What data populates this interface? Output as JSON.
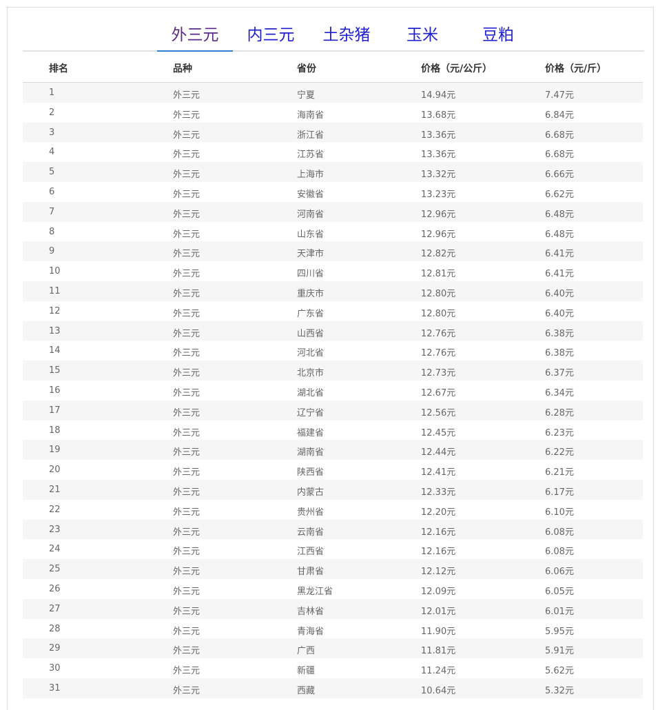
{
  "tabs": [
    "外三元",
    "内三元",
    "土杂猪",
    "玉米",
    "豆粕"
  ],
  "active_tab": 0,
  "colors": {
    "tab_text": "#1f1fcf",
    "tab_active_text": "#5b2a86",
    "tab_underline": "#2f7fd1",
    "zebra": "#f6f6f6"
  },
  "table": {
    "headers": [
      "排名",
      "品种",
      "省份",
      "价格（元/公斤）",
      "价格（元/斤）"
    ],
    "rows": [
      [
        "1",
        "外三元",
        "宁夏",
        "14.94元",
        "7.47元"
      ],
      [
        "2",
        "外三元",
        "海南省",
        "13.68元",
        "6.84元"
      ],
      [
        "3",
        "外三元",
        "浙江省",
        "13.36元",
        "6.68元"
      ],
      [
        "4",
        "外三元",
        "江苏省",
        "13.36元",
        "6.68元"
      ],
      [
        "5",
        "外三元",
        "上海市",
        "13.32元",
        "6.66元"
      ],
      [
        "6",
        "外三元",
        "安徽省",
        "13.23元",
        "6.62元"
      ],
      [
        "7",
        "外三元",
        "河南省",
        "12.96元",
        "6.48元"
      ],
      [
        "8",
        "外三元",
        "山东省",
        "12.96元",
        "6.48元"
      ],
      [
        "9",
        "外三元",
        "天津市",
        "12.82元",
        "6.41元"
      ],
      [
        "10",
        "外三元",
        "四川省",
        "12.81元",
        "6.41元"
      ],
      [
        "11",
        "外三元",
        "重庆市",
        "12.80元",
        "6.40元"
      ],
      [
        "12",
        "外三元",
        "广东省",
        "12.80元",
        "6.40元"
      ],
      [
        "13",
        "外三元",
        "山西省",
        "12.76元",
        "6.38元"
      ],
      [
        "14",
        "外三元",
        "河北省",
        "12.76元",
        "6.38元"
      ],
      [
        "15",
        "外三元",
        "北京市",
        "12.73元",
        "6.37元"
      ],
      [
        "16",
        "外三元",
        "湖北省",
        "12.67元",
        "6.34元"
      ],
      [
        "17",
        "外三元",
        "辽宁省",
        "12.56元",
        "6.28元"
      ],
      [
        "18",
        "外三元",
        "福建省",
        "12.45元",
        "6.23元"
      ],
      [
        "19",
        "外三元",
        "湖南省",
        "12.44元",
        "6.22元"
      ],
      [
        "20",
        "外三元",
        "陕西省",
        "12.41元",
        "6.21元"
      ],
      [
        "21",
        "外三元",
        "内蒙古",
        "12.33元",
        "6.17元"
      ],
      [
        "22",
        "外三元",
        "贵州省",
        "12.20元",
        "6.10元"
      ],
      [
        "23",
        "外三元",
        "云南省",
        "12.16元",
        "6.08元"
      ],
      [
        "24",
        "外三元",
        "江西省",
        "12.16元",
        "6.08元"
      ],
      [
        "25",
        "外三元",
        "甘肃省",
        "12.12元",
        "6.06元"
      ],
      [
        "26",
        "外三元",
        "黑龙江省",
        "12.09元",
        "6.05元"
      ],
      [
        "27",
        "外三元",
        "吉林省",
        "12.01元",
        "6.01元"
      ],
      [
        "28",
        "外三元",
        "青海省",
        "11.90元",
        "5.95元"
      ],
      [
        "29",
        "外三元",
        "广西",
        "11.81元",
        "5.91元"
      ],
      [
        "30",
        "外三元",
        "新疆",
        "11.24元",
        "5.62元"
      ],
      [
        "31",
        "外三元",
        "西藏",
        "10.64元",
        "5.32元"
      ]
    ]
  }
}
